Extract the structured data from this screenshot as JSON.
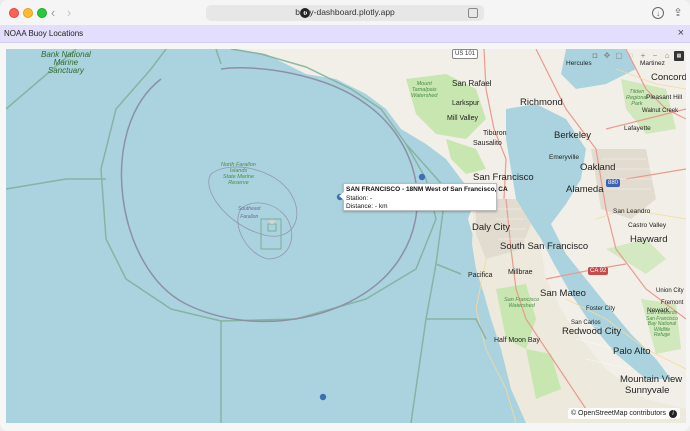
{
  "browser": {
    "url": "buoy-dashboard.plotly.app"
  },
  "banner": {
    "title": "NOAA Buoy Locations",
    "close": "×"
  },
  "map": {
    "labels": {
      "sanctuary": "Bank National\nMarine\nSanctuary",
      "farallon": "North Farallon\nIslands\nState Marine\nReserve",
      "southeast": "Southeast\nFarallon",
      "mount_tam": "Mount\nTamalpais\nWatershed",
      "sf_watershed": "San Francisco\nWatershed",
      "sf_bay": "San Francisco\nWatershed",
      "tilden": "Tilden\nRegional\nPark",
      "dumbarton": "Don Edwards\nSan Francisco\nBay National\nWildlife\nRefuge"
    },
    "cities": [
      {
        "name": "San Rafael",
        "big": false
      },
      {
        "name": "Larkspur",
        "big": false
      },
      {
        "name": "Mill Valley",
        "big": false
      },
      {
        "name": "Tiburon",
        "big": false
      },
      {
        "name": "Sausalito",
        "big": false
      },
      {
        "name": "Richmond",
        "big": true
      },
      {
        "name": "Berkeley",
        "big": true
      },
      {
        "name": "Emeryville",
        "big": false
      },
      {
        "name": "Oakland",
        "big": true
      },
      {
        "name": "Alameda",
        "big": true
      },
      {
        "name": "San Francisco",
        "big": true
      },
      {
        "name": "Daly City",
        "big": true
      },
      {
        "name": "South San Francisco",
        "big": true
      },
      {
        "name": "Pacifica",
        "big": false
      },
      {
        "name": "Millbrae",
        "big": false
      },
      {
        "name": "San Mateo",
        "big": true
      },
      {
        "name": "Half Moon Bay",
        "big": false
      },
      {
        "name": "Redwood City",
        "big": true
      },
      {
        "name": "Palo Alto",
        "big": true
      },
      {
        "name": "Mountain View",
        "big": true
      },
      {
        "name": "Sunnyvale",
        "big": true
      },
      {
        "name": "Hayward",
        "big": true
      },
      {
        "name": "San Leandro",
        "big": false
      },
      {
        "name": "Castro Valley",
        "big": false
      },
      {
        "name": "Concord",
        "big": true
      },
      {
        "name": "Martinez",
        "big": false
      },
      {
        "name": "Pleasant Hill",
        "big": false
      },
      {
        "name": "Lafayette",
        "big": false
      },
      {
        "name": "Newark",
        "big": false
      },
      {
        "name": "Hercules",
        "big": false
      },
      {
        "name": "San Carlos",
        "big": false
      },
      {
        "name": "Foster City",
        "big": false
      },
      {
        "name": "Union City",
        "big": false
      },
      {
        "name": "Fremont",
        "big": false
      },
      {
        "name": "Walnut Creek",
        "big": false
      }
    ],
    "shields": {
      "us101": "US 101",
      "ca92": "CA 92",
      "i880": "880"
    },
    "tooltip": {
      "title": "SAN FRANCISCO - 18NM West of San Francisco, CA",
      "station": "Station: -",
      "distance": "Distance: - km"
    },
    "attribution": "© OpenStreetMap contributors",
    "colors": {
      "water": "#aad3df",
      "land": "#f2efe9",
      "park": "#c8e6b0",
      "marker": "#3b6fb6"
    }
  },
  "modebar": [
    "camera-icon",
    "zoom-icon",
    "pan-icon",
    "select-icon",
    "lasso-icon",
    "zoom-in-icon",
    "zoom-out-icon",
    "autoscale-icon",
    "reset-icon",
    "plotly-logo"
  ]
}
